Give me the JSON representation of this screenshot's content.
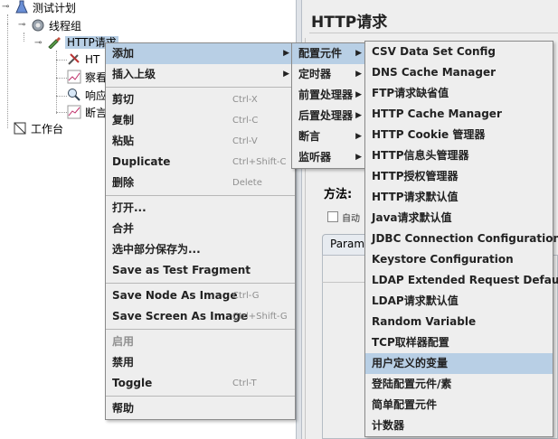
{
  "tree": {
    "test_plan": "测试计划",
    "thread_group": "线程组",
    "http_request": "HTTP请求",
    "child1": "HT",
    "child2": "察看",
    "child3": "响应",
    "child4": "断言",
    "workbench": "工作台"
  },
  "right_panel": {
    "title": "HTTP请求",
    "method_label": "方法:",
    "auto_label": "自动",
    "param_tab": "Param"
  },
  "context_menu": {
    "items": [
      {
        "label": "添加",
        "shortcut": "",
        "submenu": true
      },
      {
        "label": "插入上级",
        "shortcut": "",
        "submenu": true
      },
      {
        "label": "剪切",
        "shortcut": "Ctrl-X"
      },
      {
        "label": "复制",
        "shortcut": "Ctrl-C"
      },
      {
        "label": "粘贴",
        "shortcut": "Ctrl-V"
      },
      {
        "label": "Duplicate",
        "shortcut": "Ctrl+Shift-C"
      },
      {
        "label": "删除",
        "shortcut": "Delete"
      },
      {
        "label": "打开...",
        "shortcut": ""
      },
      {
        "label": "合并",
        "shortcut": ""
      },
      {
        "label": "选中部分保存为...",
        "shortcut": ""
      },
      {
        "label": "Save as Test Fragment",
        "shortcut": ""
      },
      {
        "label": "Save Node As Image",
        "shortcut": "Ctrl-G"
      },
      {
        "label": "Save Screen As Image",
        "shortcut": "Ctrl+Shift-G"
      },
      {
        "label": "启用",
        "shortcut": ""
      },
      {
        "label": "禁用",
        "shortcut": ""
      },
      {
        "label": "Toggle",
        "shortcut": "Ctrl-T"
      },
      {
        "label": "帮助",
        "shortcut": ""
      }
    ]
  },
  "add_menu": {
    "items": [
      "配置元件",
      "定时器",
      "前置处理器",
      "后置处理器",
      "断言",
      "监听器"
    ]
  },
  "config_menu": {
    "items": [
      "CSV Data Set Config",
      "DNS Cache Manager",
      "FTP请求缺省值",
      "HTTP Cache Manager",
      "HTTP Cookie 管理器",
      "HTTP信息头管理器",
      "HTTP授权管理器",
      "HTTP请求默认值",
      "Java请求默认值",
      "JDBC Connection Configuration",
      "Keystore Configuration",
      "LDAP Extended Request Defaults",
      "LDAP请求默认值",
      "Random Variable",
      "TCP取样器配置",
      "用户定义的变量",
      "登陆配置元件/素",
      "简单配置元件",
      "计数器"
    ]
  },
  "colors": {
    "highlight": "#b8cfe5",
    "menu_bg": "#eeeeee"
  }
}
